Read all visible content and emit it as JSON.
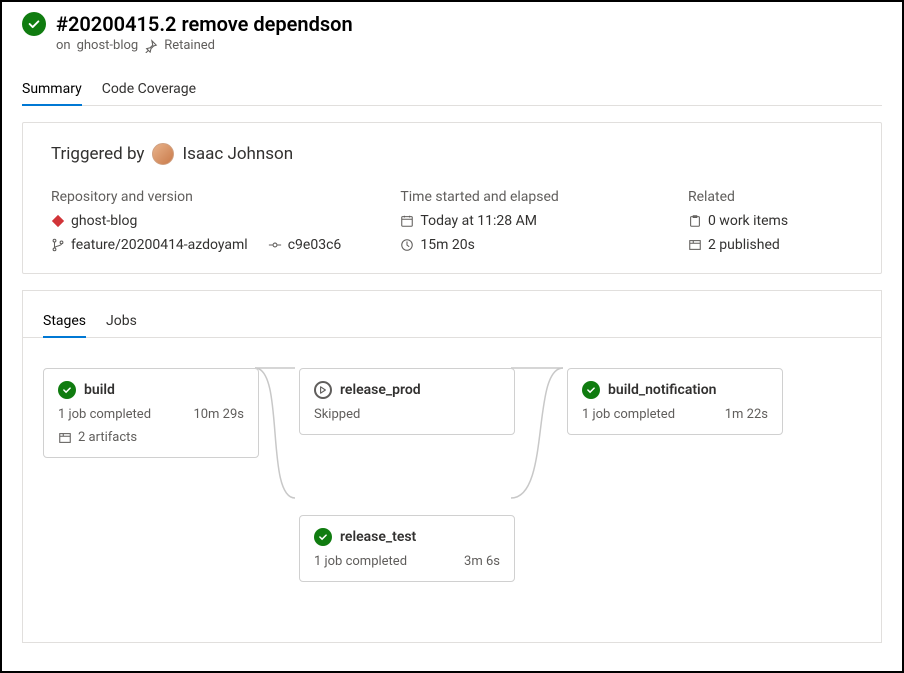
{
  "header": {
    "title": "#20200415.2 remove dependson",
    "project_prefix": "on",
    "project": "ghost-blog",
    "retained": "Retained"
  },
  "tabs": {
    "summary": "Summary",
    "coverage": "Code Coverage"
  },
  "triggered": {
    "prefix": "Triggered by",
    "user": "Isaac Johnson"
  },
  "info": {
    "repo_label": "Repository and version",
    "repo": "ghost-blog",
    "branch": "feature/20200414-azdoyaml",
    "commit": "c9e03c6",
    "time_label": "Time started and elapsed",
    "started": "Today at 11:28 AM",
    "elapsed": "15m 20s",
    "related_label": "Related",
    "work_items": "0 work items",
    "published": "2 published"
  },
  "stages_tabs": {
    "stages": "Stages",
    "jobs": "Jobs"
  },
  "stages": {
    "build": {
      "name": "build",
      "status_text": "1 job completed",
      "duration": "10m 29s",
      "artifacts": "2 artifacts"
    },
    "release_prod": {
      "name": "release_prod",
      "status_text": "Skipped"
    },
    "release_test": {
      "name": "release_test",
      "status_text": "1 job completed",
      "duration": "3m 6s"
    },
    "build_notification": {
      "name": "build_notification",
      "status_text": "1 job completed",
      "duration": "1m 22s"
    }
  }
}
